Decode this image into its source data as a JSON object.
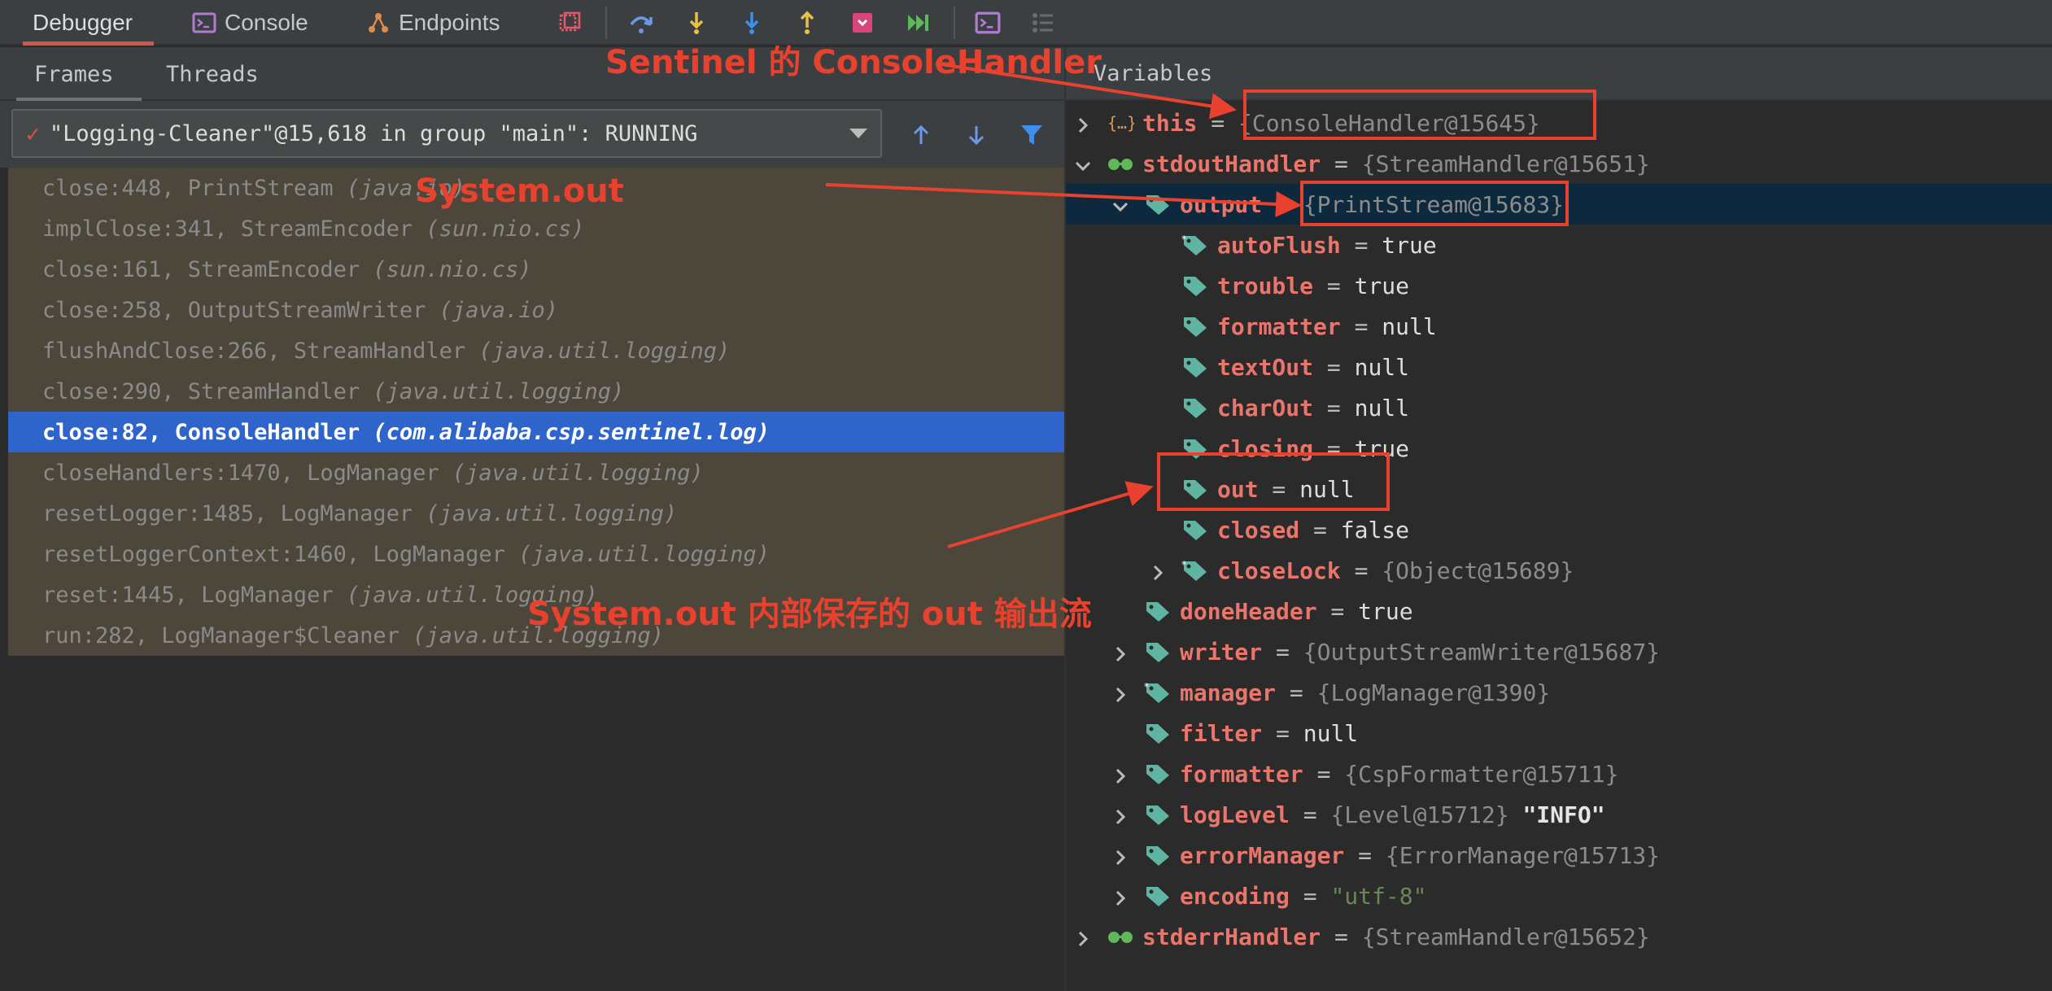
{
  "toolbar": {
    "tabs": [
      {
        "label": "Debugger"
      },
      {
        "label": "Console"
      },
      {
        "label": "Endpoints"
      }
    ]
  },
  "frames_panel": {
    "tabs": [
      {
        "label": "Frames"
      },
      {
        "label": "Threads"
      }
    ],
    "thread_selector": "\"Logging-Cleaner\"@15,618 in group \"main\": RUNNING",
    "frames": [
      {
        "method": "close:448, PrintStream ",
        "pkg": "(java.io)"
      },
      {
        "method": "implClose:341, StreamEncoder ",
        "pkg": "(sun.nio.cs)"
      },
      {
        "method": "close:161, StreamEncoder ",
        "pkg": "(sun.nio.cs)"
      },
      {
        "method": "close:258, OutputStreamWriter ",
        "pkg": "(java.io)"
      },
      {
        "method": "flushAndClose:266, StreamHandler ",
        "pkg": "(java.util.logging)"
      },
      {
        "method": "close:290, StreamHandler ",
        "pkg": "(java.util.logging)"
      },
      {
        "method": "close:82, ConsoleHandler ",
        "pkg": "(com.alibaba.csp.sentinel.log)"
      },
      {
        "method": "closeHandlers:1470, LogManager ",
        "pkg": "(java.util.logging)"
      },
      {
        "method": "resetLogger:1485, LogManager ",
        "pkg": "(java.util.logging)"
      },
      {
        "method": "resetLoggerContext:1460, LogManager ",
        "pkg": "(java.util.logging)"
      },
      {
        "method": "reset:1445, LogManager ",
        "pkg": "(java.util.logging)"
      },
      {
        "method": "run:282, LogManager$Cleaner ",
        "pkg": "(java.util.logging)"
      }
    ]
  },
  "variables_panel": {
    "title": "Variables",
    "vars": [
      {
        "name": "this",
        "eq": " = ",
        "value": "{ConsoleHandler@15645}",
        "extra": ""
      },
      {
        "name": "stdoutHandler",
        "eq": " = ",
        "value": "{StreamHandler@15651}",
        "extra": ""
      },
      {
        "name": "output",
        "eq": " = ",
        "value": "{PrintStream@15683}",
        "extra": ""
      },
      {
        "name": "autoFlush",
        "eq": " = ",
        "value": "true",
        "extra": ""
      },
      {
        "name": "trouble",
        "eq": " = ",
        "value": "true",
        "extra": ""
      },
      {
        "name": "formatter",
        "eq": " = ",
        "value": "null",
        "extra": ""
      },
      {
        "name": "textOut",
        "eq": " = ",
        "value": "null",
        "extra": ""
      },
      {
        "name": "charOut",
        "eq": " = ",
        "value": "null",
        "extra": ""
      },
      {
        "name": "closing",
        "eq": " = ",
        "value": "true",
        "extra": ""
      },
      {
        "name": "out",
        "eq": " = ",
        "value": "null",
        "extra": ""
      },
      {
        "name": "closed",
        "eq": " = ",
        "value": "false",
        "extra": ""
      },
      {
        "name": "closeLock",
        "eq": " = ",
        "value": "{Object@15689}",
        "extra": ""
      },
      {
        "name": "doneHeader",
        "eq": " = ",
        "value": "true",
        "extra": ""
      },
      {
        "name": "writer",
        "eq": " = ",
        "value": "{OutputStreamWriter@15687}",
        "extra": ""
      },
      {
        "name": "manager",
        "eq": " = ",
        "value": "{LogManager@1390}",
        "extra": ""
      },
      {
        "name": "filter",
        "eq": " = ",
        "value": "null",
        "extra": ""
      },
      {
        "name": "formatter",
        "eq": " = ",
        "value": "{CspFormatter@15711}",
        "extra": ""
      },
      {
        "name": "logLevel",
        "eq": " = ",
        "value": "{Level@15712}",
        "extra": " \"INFO\""
      },
      {
        "name": "errorManager",
        "eq": " = ",
        "value": "{ErrorManager@15713}",
        "extra": ""
      },
      {
        "name": "encoding",
        "eq": " = ",
        "value": "\"utf-8\"",
        "extra": ""
      },
      {
        "name": "stderrHandler",
        "eq": " = ",
        "value": "{StreamHandler@15652}",
        "extra": ""
      }
    ]
  },
  "annotations": {
    "sentinel_handler": "Sentinel 的 ConsoleHandler",
    "system_out": "System.out",
    "inner_out": "System.out 内部保存的 out 输出流"
  },
  "colors": {
    "annotation": "#e8422e",
    "selected_frame": "#2f65ca",
    "field_name": "#e9766c",
    "tag_icon": "#5fb4a2"
  }
}
